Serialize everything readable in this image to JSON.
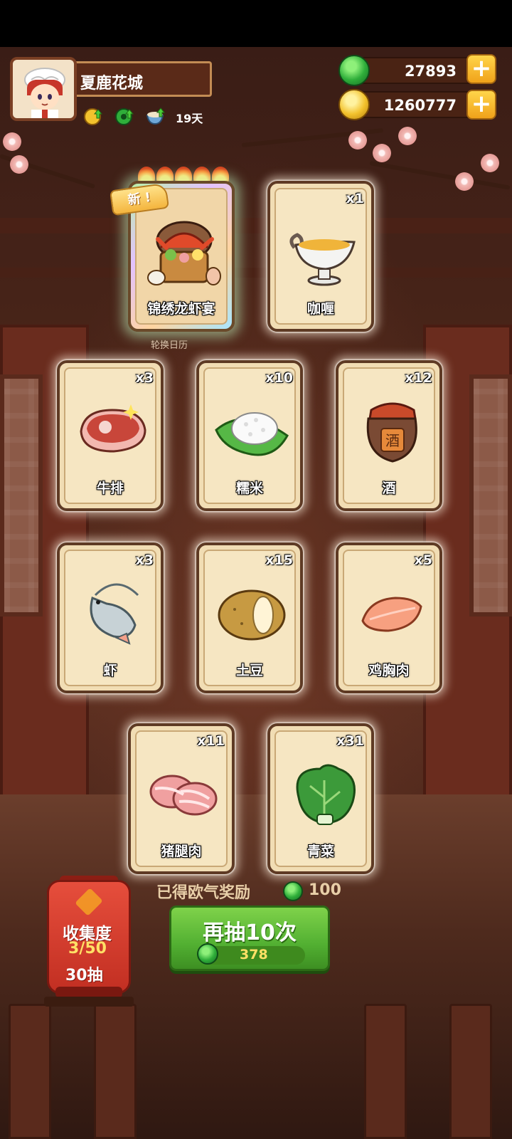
{
  "profile": {
    "name": "夏鹿花城",
    "days": "19天",
    "status_icons": [
      "coin-upgrade-icon",
      "jade-upgrade-icon",
      "bowl-upgrade-icon"
    ]
  },
  "currency": {
    "jade": "27893",
    "coins": "1260777"
  },
  "featured": {
    "badge": "新",
    "flames": 5,
    "sublabel": "轮换日历"
  },
  "cards": [
    {
      "label": "锦绣龙虾宴",
      "count": "",
      "icon": "lobster-feast-icon",
      "rare": true
    },
    {
      "label": "咖喱",
      "count": "x1",
      "icon": "curry-gravy-boat-icon"
    },
    {
      "label": "牛排",
      "count": "x3",
      "icon": "steak-icon"
    },
    {
      "label": "糯米",
      "count": "x10",
      "icon": "sticky-rice-icon"
    },
    {
      "label": "酒",
      "count": "x12",
      "icon": "wine-jar-icon",
      "jar_text": "酒"
    },
    {
      "label": "虾",
      "count": "x3",
      "icon": "shrimp-icon"
    },
    {
      "label": "土豆",
      "count": "x15",
      "icon": "potato-icon"
    },
    {
      "label": "鸡胸肉",
      "count": "x5",
      "icon": "chicken-breast-icon"
    },
    {
      "label": "猪腿肉",
      "count": "x11",
      "icon": "pork-leg-icon"
    },
    {
      "label": "青菜",
      "count": "x31",
      "icon": "bok-choy-icon"
    }
  ],
  "reward": {
    "label": "已得欧气奖励",
    "value": "100"
  },
  "collection": {
    "title": "收集度",
    "progress": "3/50",
    "draws": "30抽"
  },
  "draw_button": {
    "label": "再抽10次",
    "cost": "378"
  },
  "colors": {
    "button_green": "#52b032",
    "jade_green": "#2fae3a",
    "coin_gold": "#f3c22d",
    "lantern_red": "#c22f22",
    "card_beige": "#f1ddb4"
  }
}
